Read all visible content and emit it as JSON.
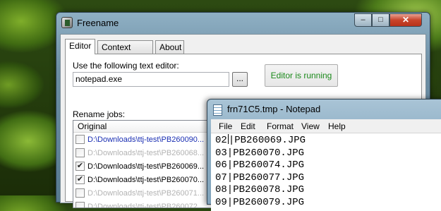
{
  "freename": {
    "title": "Freename",
    "caption_buttons": {
      "minimize": "–",
      "maximize": "□",
      "close": "✕"
    },
    "tabs": [
      {
        "label": "Editor",
        "active": true
      },
      {
        "label": "Context menu",
        "active": false
      },
      {
        "label": "About",
        "active": false
      }
    ],
    "editor": {
      "label": "Use the following text editor:",
      "value": "notepad.exe",
      "browse_label": "...",
      "status_label": "Editor is running",
      "status_color": "#1c8a1c"
    },
    "rename": {
      "label": "Rename jobs:",
      "column_header": "Original",
      "rows": [
        {
          "checked": false,
          "path": "D:\\Downloads\\ttj-test\\PB260090...",
          "state": "blue"
        },
        {
          "checked": false,
          "path": "D:\\Downloads\\ttj-test\\PB260068...",
          "state": "grey"
        },
        {
          "checked": true,
          "path": "D:\\Downloads\\ttj-test\\PB260069...",
          "state": "black"
        },
        {
          "checked": true,
          "path": "D:\\Downloads\\ttj-test\\PB260070...",
          "state": "black"
        },
        {
          "checked": false,
          "path": "D:\\Downloads\\ttj-test\\PB260071...",
          "state": "grey"
        },
        {
          "checked": false,
          "path": "D:\\Downloads\\ttj-test\\PB260072...",
          "state": "grey"
        }
      ]
    }
  },
  "notepad": {
    "title": "frn71C5.tmp - Notepad",
    "menu": [
      "File",
      "Edit",
      "Format",
      "View",
      "Help"
    ],
    "lines": [
      "02|PB260069.JPG",
      "03|PB260070.JPG",
      "06|PB260074.JPG",
      "07|PB260077.JPG",
      "08|PB260078.JPG",
      "09|PB260079.JPG"
    ]
  },
  "colors": {
    "row_blue": "#1a2fb3",
    "row_grey": "#b3b3b3",
    "status_green": "#1c8a1c"
  }
}
